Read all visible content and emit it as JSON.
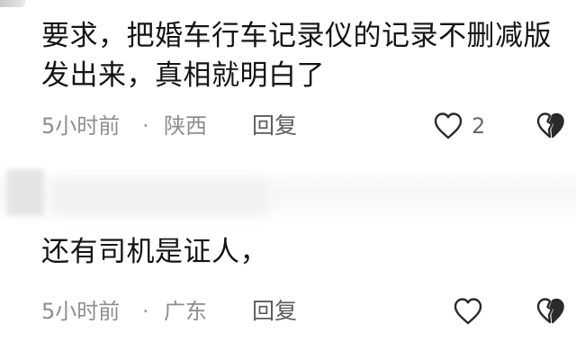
{
  "comments": [
    {
      "text": "要求，把婚车行车记录仪的记录不删减版发出来，真相就明白了",
      "time": "5小时前",
      "separator": "·",
      "location": "陕西",
      "reply_label": "回复",
      "like_count": "2",
      "icons": [
        "heart-outline-icon",
        "broken-heart-icon"
      ]
    },
    {
      "text": "还有司机是证人，",
      "time": "5小时前",
      "separator": "·",
      "location": "广东",
      "reply_label": "回复",
      "like_count": "",
      "icons": [
        "heart-outline-icon",
        "broken-heart-icon"
      ]
    }
  ],
  "colors": {
    "text": "#141414",
    "meta": "#8e8e8e",
    "reply": "#5d5d5d",
    "icon": "#2a2a2a"
  }
}
